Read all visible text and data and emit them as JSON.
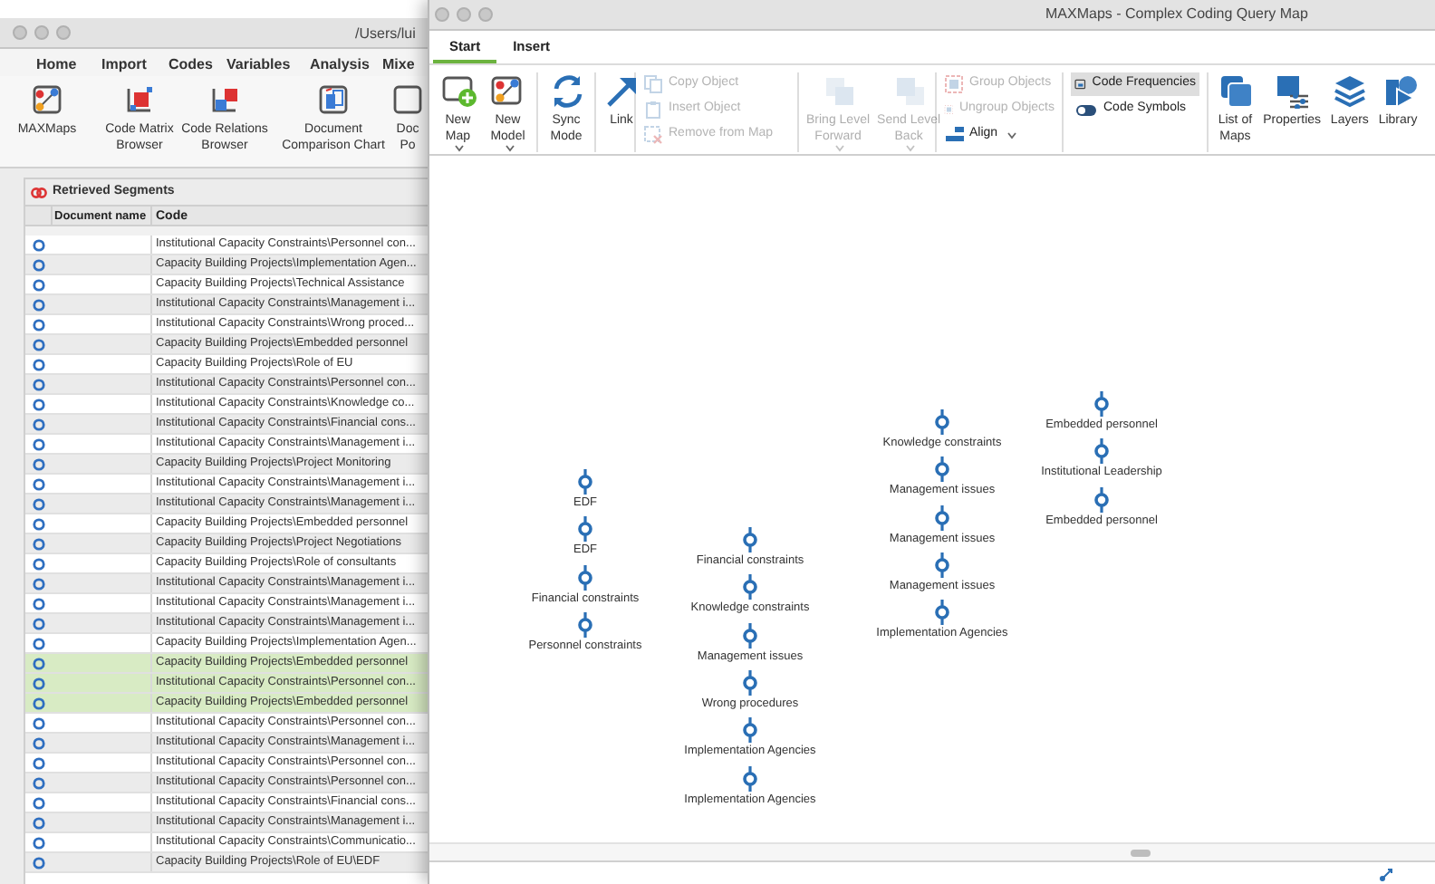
{
  "back_window": {
    "title": "/Users/lui",
    "tabs": [
      {
        "label": "Home"
      },
      {
        "label": "Import"
      },
      {
        "label": "Codes"
      },
      {
        "label": "Variables"
      },
      {
        "label": "Analysis"
      },
      {
        "label": "Mixe"
      }
    ],
    "ribbon": [
      {
        "kind": "maxmaps",
        "lines": [
          "MAXMaps"
        ]
      },
      {
        "kind": "matrix",
        "lines": [
          "Code Matrix",
          "Browser"
        ]
      },
      {
        "kind": "relations",
        "lines": [
          "Code Relations",
          "Browser"
        ]
      },
      {
        "kind": "comparison",
        "lines": [
          "Document",
          "Comparison Chart"
        ]
      },
      {
        "kind": "doc",
        "lines": [
          "Doc",
          "Po"
        ]
      }
    ],
    "panel_title": "Retrieved Segments",
    "columns": [
      "Document name",
      "Code"
    ],
    "rows": [
      {
        "code": "Institutional Capacity Constraints\\Personnel con...",
        "selected": false
      },
      {
        "code": "Capacity Building Projects\\Implementation Agen...",
        "selected": false
      },
      {
        "code": "Capacity Building Projects\\Technical Assistance",
        "selected": false
      },
      {
        "code": "Institutional Capacity Constraints\\Management i...",
        "selected": false
      },
      {
        "code": "Institutional Capacity Constraints\\Wrong proced...",
        "selected": false
      },
      {
        "code": "Capacity Building Projects\\Embedded personnel",
        "selected": false
      },
      {
        "code": "Capacity Building Projects\\Role of EU",
        "selected": false
      },
      {
        "code": "Institutional Capacity Constraints\\Personnel con...",
        "selected": false
      },
      {
        "code": "Institutional Capacity Constraints\\Knowledge co...",
        "selected": false
      },
      {
        "code": "Institutional Capacity Constraints\\Financial cons...",
        "selected": false
      },
      {
        "code": "Institutional Capacity Constraints\\Management i...",
        "selected": false
      },
      {
        "code": "Capacity Building Projects\\Project Monitoring",
        "selected": false
      },
      {
        "code": "Institutional Capacity Constraints\\Management i...",
        "selected": false
      },
      {
        "code": "Institutional Capacity Constraints\\Management i...",
        "selected": false
      },
      {
        "code": "Capacity Building Projects\\Embedded personnel",
        "selected": false
      },
      {
        "code": "Capacity Building Projects\\Project Negotiations",
        "selected": false
      },
      {
        "code": "Capacity Building Projects\\Role of consultants",
        "selected": false
      },
      {
        "code": "Institutional Capacity Constraints\\Management i...",
        "selected": false
      },
      {
        "code": "Institutional Capacity Constraints\\Management i...",
        "selected": false
      },
      {
        "code": "Institutional Capacity Constraints\\Management i...",
        "selected": false
      },
      {
        "code": "Capacity Building Projects\\Implementation Agen...",
        "selected": false
      },
      {
        "code": "Capacity Building Projects\\Embedded personnel",
        "selected": true
      },
      {
        "code": "Institutional Capacity Constraints\\Personnel con...",
        "selected": true
      },
      {
        "code": "Capacity Building Projects\\Embedded personnel",
        "selected": true
      },
      {
        "code": "Institutional Capacity Constraints\\Personnel con...",
        "selected": false
      },
      {
        "code": "Institutional Capacity Constraints\\Management i...",
        "selected": false
      },
      {
        "code": "Institutional Capacity Constraints\\Personnel con...",
        "selected": false
      },
      {
        "code": "Institutional Capacity Constraints\\Personnel con...",
        "selected": false
      },
      {
        "code": "Institutional Capacity Constraints\\Financial cons...",
        "selected": false
      },
      {
        "code": "Institutional Capacity Constraints\\Management i...",
        "selected": false
      },
      {
        "code": "Institutional Capacity Constraints\\Communicatio...",
        "selected": false
      },
      {
        "code": "Capacity Building Projects\\Role of EU\\EDF",
        "selected": false
      }
    ]
  },
  "window": {
    "title": "MAXMaps - Complex Coding Query Map",
    "tabs": [
      {
        "label": "Start",
        "selected": true
      },
      {
        "label": "Insert",
        "selected": false
      }
    ],
    "ribbon": [
      {
        "kind": "large",
        "items": [
          {
            "lines": [
              "New",
              "Map"
            ],
            "dropdown": true,
            "disabled": false
          },
          {
            "lines": [
              "New",
              "Model"
            ],
            "dropdown": true,
            "disabled": false
          }
        ]
      },
      {
        "kind": "large",
        "items": [
          {
            "lines": [
              "Sync",
              "Mode"
            ],
            "dropdown": false,
            "disabled": false
          }
        ]
      },
      {
        "kind": "large",
        "items": [
          {
            "lines": [
              "Link"
            ],
            "dropdown": false,
            "disabled": false
          }
        ]
      },
      {
        "kind": "small",
        "items": [
          {
            "label": "Copy Object",
            "disabled": true,
            "dropdown": false
          },
          {
            "label": "Insert Object",
            "disabled": true,
            "dropdown": false
          },
          {
            "label": "Remove from Map",
            "disabled": true,
            "dropdown": false
          }
        ]
      },
      {
        "kind": "large",
        "items": [
          {
            "lines": [
              "Bring Level",
              "Forward"
            ],
            "dropdown": true,
            "disabled": true
          },
          {
            "lines": [
              "Send Level",
              "Back"
            ],
            "dropdown": true,
            "disabled": true
          }
        ]
      },
      {
        "kind": "small",
        "items": [
          {
            "label": "Group Objects",
            "disabled": true,
            "dropdown": false
          },
          {
            "label": "Ungroup Objects",
            "disabled": true,
            "dropdown": false
          },
          {
            "label": "Align",
            "disabled": false,
            "dropdown": true
          }
        ]
      },
      {
        "kind": "toggle",
        "items": [
          {
            "label": "Code Frequencies",
            "selected": true
          },
          {
            "label": "Code Symbols",
            "selected": false
          }
        ]
      },
      {
        "kind": "large",
        "items": [
          {
            "lines": [
              "List of",
              "Maps"
            ],
            "dropdown": false,
            "disabled": false
          },
          {
            "lines": [
              "Properties"
            ],
            "dropdown": false,
            "disabled": false
          },
          {
            "lines": [
              "Layers"
            ],
            "dropdown": false,
            "disabled": false
          },
          {
            "lines": [
              "Library"
            ],
            "dropdown": false,
            "disabled": false
          }
        ]
      }
    ],
    "map_clusters": [
      {
        "nodes": [
          "EDF",
          "EDF",
          "Financial constraints",
          "Personnel constraints"
        ]
      },
      {
        "nodes": [
          "Financial constraints",
          "Knowledge constraints",
          "Management issues",
          "Wrong procedures",
          "Implementation Agencies",
          "Implementation Agencies"
        ]
      },
      {
        "nodes": [
          "Knowledge constraints",
          "Management issues",
          "Management issues",
          "Management issues",
          "Implementation Agencies"
        ]
      },
      {
        "nodes": [
          "Embedded personnel",
          "Institutional Leadership",
          "Embedded personnel"
        ]
      }
    ]
  }
}
